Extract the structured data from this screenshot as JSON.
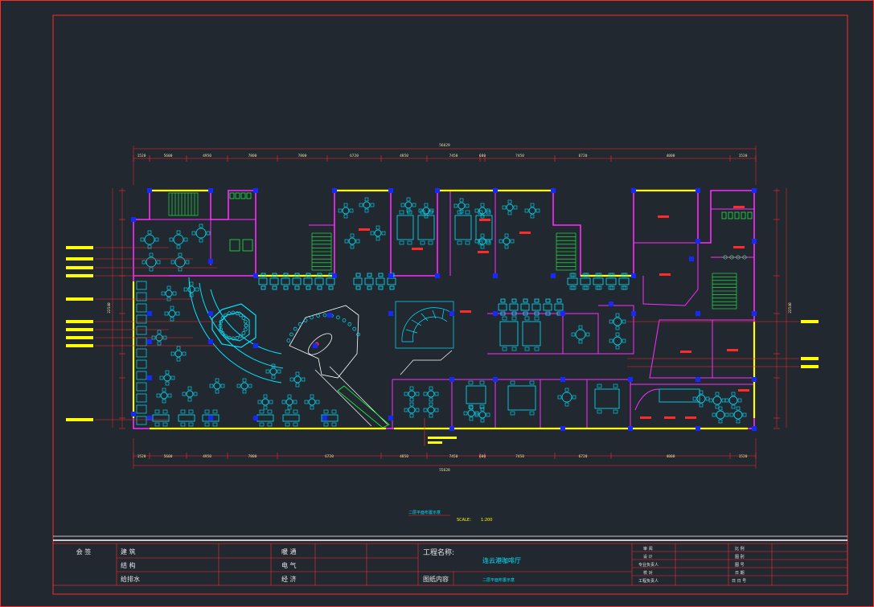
{
  "drawing": {
    "caption": "二层平面布置示意",
    "scale_label": "SCALE：",
    "scale_value": "1:200"
  },
  "dimensions": {
    "top_total": "56629",
    "bottom_total": "55628",
    "top_segments": [
      "1520",
      "5600",
      "4950",
      "7800",
      "7800",
      "6720",
      "4850",
      "7450",
      "600",
      "7450",
      "6720",
      "4000",
      "1520"
    ],
    "bottom_segments": [
      "1520",
      "5600",
      "4950",
      "7800",
      "6720",
      "4850",
      "7450",
      "600",
      "7450",
      "6720",
      "4000",
      "1520"
    ],
    "left_total": "22540",
    "right_total": "22540"
  },
  "title_block": {
    "sign_label": "会 签",
    "disciplines": [
      {
        "left": "建 筑",
        "right": "暖 通"
      },
      {
        "left": "结 构",
        "right": "电 气"
      },
      {
        "left": "给排水",
        "right": "经 济"
      }
    ],
    "project_name_label": "工程名称:",
    "project_name_value": "连云港咖啡厅",
    "drawing_content_label": "图纸内容",
    "drawing_content_value": "二层平面布置示意",
    "roles": [
      "审 阅",
      "设 计",
      "专业负责人",
      "校 对",
      "工程负责人"
    ],
    "info": [
      "比 例",
      "图 别",
      "图 号",
      "日 期",
      "日 日 号"
    ]
  },
  "colors": {
    "background": "#212830",
    "frame": "#ff2a2a",
    "wall": "#ff2cff",
    "column": "#1428ff",
    "furniture": "#00e5ff",
    "window": "#ffff00",
    "stairs": "#22ff44",
    "dimension": "#e8e0a0"
  }
}
